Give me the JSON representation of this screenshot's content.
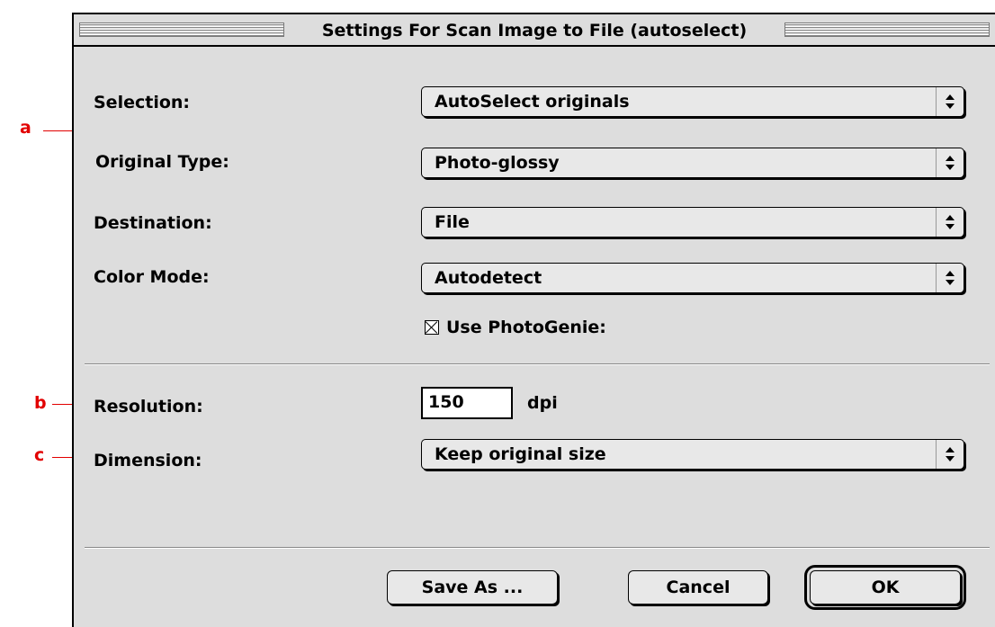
{
  "window": {
    "title": "Settings For Scan Image to File (autoselect)"
  },
  "fields": {
    "selection": {
      "label": "Selection:",
      "value": "AutoSelect originals"
    },
    "original_type": {
      "label": "Original Type:",
      "value": "Photo-glossy"
    },
    "destination": {
      "label": "Destination:",
      "value": "File"
    },
    "color_mode": {
      "label": "Color Mode:",
      "value": "Autodetect"
    },
    "photogenie": {
      "label": "Use PhotoGenie:",
      "checked": true
    },
    "resolution": {
      "label": "Resolution:",
      "value": "150",
      "unit": "dpi"
    },
    "dimension": {
      "label": "Dimension:",
      "value": "Keep original size"
    }
  },
  "buttons": {
    "save_as": "Save As ...",
    "cancel": "Cancel",
    "ok": "OK"
  },
  "callouts": {
    "a": "a",
    "b": "b",
    "c": "c"
  },
  "colors": {
    "dialog_bg": "#dddddd",
    "callout": "#e20000"
  },
  "icons": {
    "popup_arrows": "updown-arrows-icon",
    "checkbox": "checkbox-checked-icon"
  }
}
